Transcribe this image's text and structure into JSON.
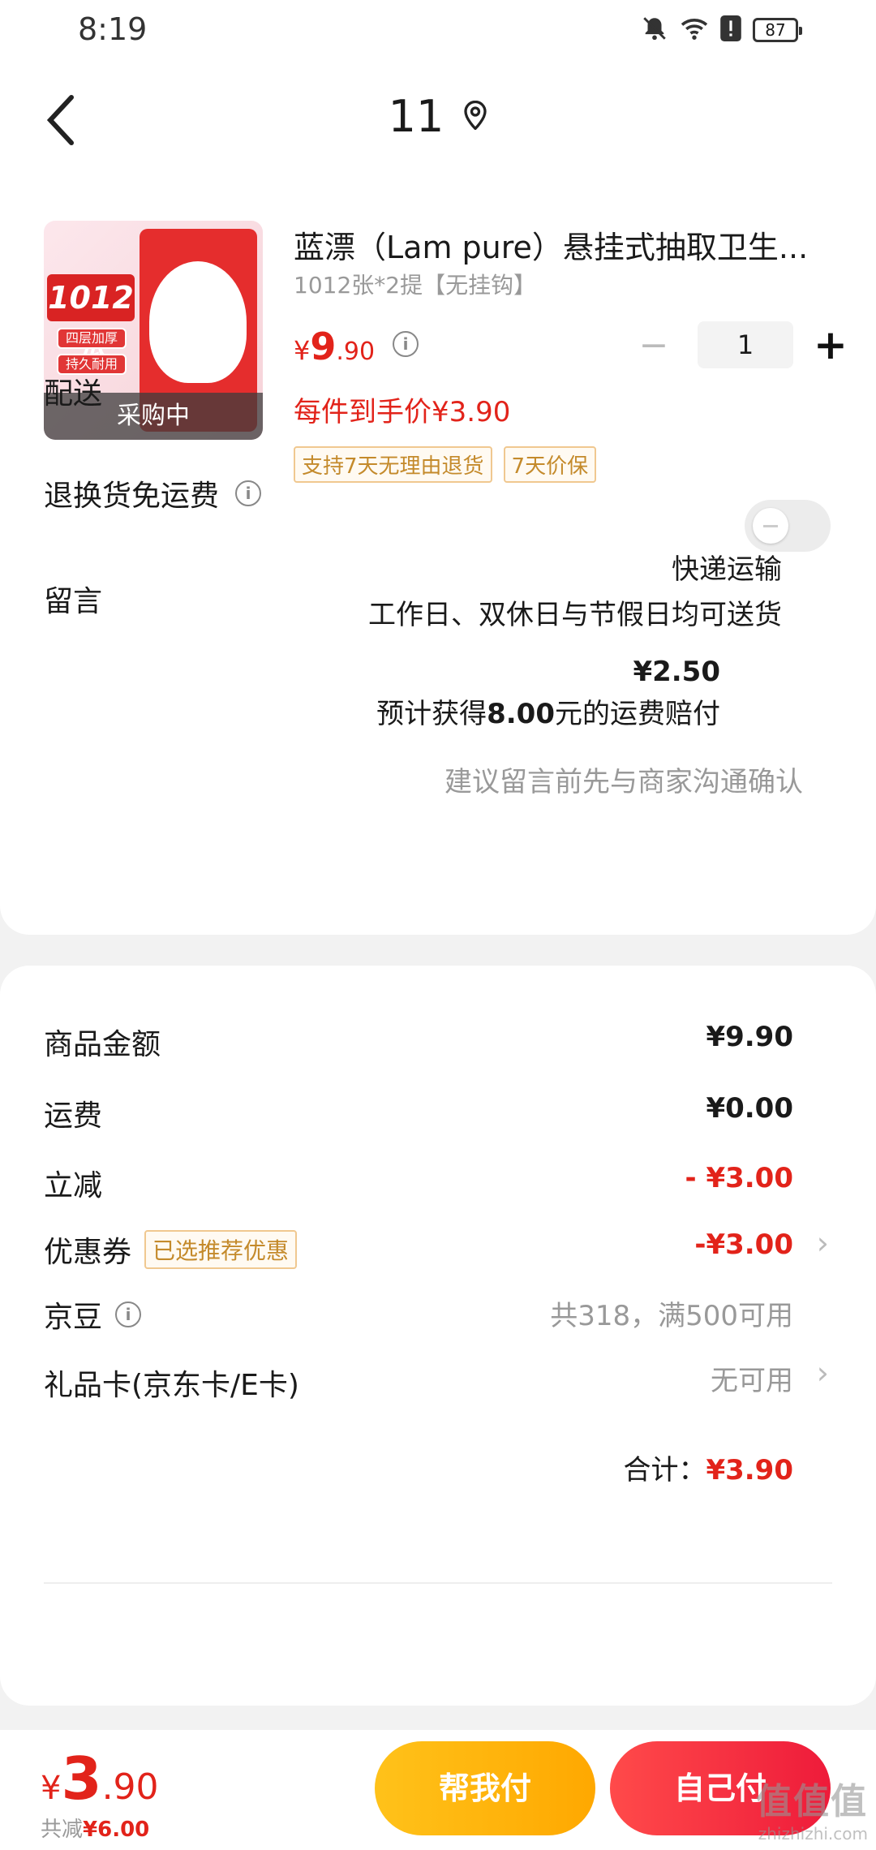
{
  "status": {
    "time": "8:19",
    "battery": "87"
  },
  "header": {
    "title": "11"
  },
  "product": {
    "name": "蓝漂（Lam pure）悬挂式抽取卫生...",
    "spec": "1012张*2提【无挂钩】",
    "price_currency": "¥",
    "price_int": "9",
    "price_dec": ".90",
    "quantity": "1",
    "hand_price": "每件到手价¥3.90",
    "image_badge": "1012张",
    "image_chip1": "四层加厚",
    "image_chip2": "持久耐用",
    "image_status": "采购中",
    "tags": [
      "支持7天无理由退货",
      "7天价保"
    ]
  },
  "delivery": {
    "label": "配送",
    "method": "快递运输",
    "schedule": "工作日、双休日与节假日均可送货"
  },
  "return_insurance": {
    "label": "退换货免运费",
    "price": "¥2.50",
    "note_prefix": "预计获得",
    "note_amount": "8.00",
    "note_suffix": "元的运费赔付",
    "enabled": false
  },
  "message": {
    "label": "留言",
    "placeholder": "建议留言前先与商家沟通确认"
  },
  "summary": {
    "goods_label": "商品金额",
    "goods_value": "¥9.90",
    "shipping_label": "运费",
    "shipping_value": "¥0.00",
    "discount_label": "立减",
    "discount_value": "- ¥3.00",
    "coupon_label": "优惠券",
    "coupon_tag": "已选推荐优惠",
    "coupon_value": "-¥3.00",
    "jingdou_label": "京豆",
    "jingdou_value": "共318，满500可用",
    "giftcard_label": "礼品卡(京东卡/E卡)",
    "giftcard_value": "无可用",
    "total_label": "合计：",
    "total_value": "¥3.90"
  },
  "bottom_bar": {
    "currency": "¥",
    "price_int": "3",
    "price_dec": ".90",
    "saved_label": "共减",
    "saved_value": "¥6.00",
    "help_pay": "帮我付",
    "self_pay": "自己付"
  },
  "watermark": {
    "big": "值值值",
    "small": "zhizhizhi.com"
  },
  "colors": {
    "accent_red": "#e2231a",
    "tag_orange": "#c48a2b",
    "help_btn": "#ffb300",
    "self_btn": "#f02d43"
  }
}
